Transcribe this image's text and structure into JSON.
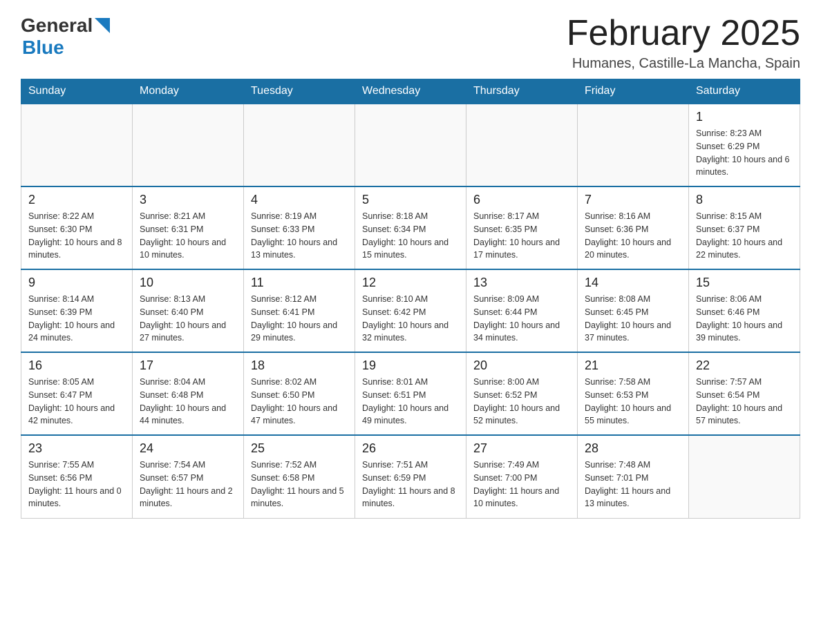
{
  "header": {
    "logo": {
      "general": "General",
      "blue": "Blue"
    },
    "title": "February 2025",
    "subtitle": "Humanes, Castille-La Mancha, Spain"
  },
  "weekdays": [
    "Sunday",
    "Monday",
    "Tuesday",
    "Wednesday",
    "Thursday",
    "Friday",
    "Saturday"
  ],
  "weeks": [
    [
      {
        "day": "",
        "info": ""
      },
      {
        "day": "",
        "info": ""
      },
      {
        "day": "",
        "info": ""
      },
      {
        "day": "",
        "info": ""
      },
      {
        "day": "",
        "info": ""
      },
      {
        "day": "",
        "info": ""
      },
      {
        "day": "1",
        "info": "Sunrise: 8:23 AM\nSunset: 6:29 PM\nDaylight: 10 hours and 6 minutes."
      }
    ],
    [
      {
        "day": "2",
        "info": "Sunrise: 8:22 AM\nSunset: 6:30 PM\nDaylight: 10 hours and 8 minutes."
      },
      {
        "day": "3",
        "info": "Sunrise: 8:21 AM\nSunset: 6:31 PM\nDaylight: 10 hours and 10 minutes."
      },
      {
        "day": "4",
        "info": "Sunrise: 8:19 AM\nSunset: 6:33 PM\nDaylight: 10 hours and 13 minutes."
      },
      {
        "day": "5",
        "info": "Sunrise: 8:18 AM\nSunset: 6:34 PM\nDaylight: 10 hours and 15 minutes."
      },
      {
        "day": "6",
        "info": "Sunrise: 8:17 AM\nSunset: 6:35 PM\nDaylight: 10 hours and 17 minutes."
      },
      {
        "day": "7",
        "info": "Sunrise: 8:16 AM\nSunset: 6:36 PM\nDaylight: 10 hours and 20 minutes."
      },
      {
        "day": "8",
        "info": "Sunrise: 8:15 AM\nSunset: 6:37 PM\nDaylight: 10 hours and 22 minutes."
      }
    ],
    [
      {
        "day": "9",
        "info": "Sunrise: 8:14 AM\nSunset: 6:39 PM\nDaylight: 10 hours and 24 minutes."
      },
      {
        "day": "10",
        "info": "Sunrise: 8:13 AM\nSunset: 6:40 PM\nDaylight: 10 hours and 27 minutes."
      },
      {
        "day": "11",
        "info": "Sunrise: 8:12 AM\nSunset: 6:41 PM\nDaylight: 10 hours and 29 minutes."
      },
      {
        "day": "12",
        "info": "Sunrise: 8:10 AM\nSunset: 6:42 PM\nDaylight: 10 hours and 32 minutes."
      },
      {
        "day": "13",
        "info": "Sunrise: 8:09 AM\nSunset: 6:44 PM\nDaylight: 10 hours and 34 minutes."
      },
      {
        "day": "14",
        "info": "Sunrise: 8:08 AM\nSunset: 6:45 PM\nDaylight: 10 hours and 37 minutes."
      },
      {
        "day": "15",
        "info": "Sunrise: 8:06 AM\nSunset: 6:46 PM\nDaylight: 10 hours and 39 minutes."
      }
    ],
    [
      {
        "day": "16",
        "info": "Sunrise: 8:05 AM\nSunset: 6:47 PM\nDaylight: 10 hours and 42 minutes."
      },
      {
        "day": "17",
        "info": "Sunrise: 8:04 AM\nSunset: 6:48 PM\nDaylight: 10 hours and 44 minutes."
      },
      {
        "day": "18",
        "info": "Sunrise: 8:02 AM\nSunset: 6:50 PM\nDaylight: 10 hours and 47 minutes."
      },
      {
        "day": "19",
        "info": "Sunrise: 8:01 AM\nSunset: 6:51 PM\nDaylight: 10 hours and 49 minutes."
      },
      {
        "day": "20",
        "info": "Sunrise: 8:00 AM\nSunset: 6:52 PM\nDaylight: 10 hours and 52 minutes."
      },
      {
        "day": "21",
        "info": "Sunrise: 7:58 AM\nSunset: 6:53 PM\nDaylight: 10 hours and 55 minutes."
      },
      {
        "day": "22",
        "info": "Sunrise: 7:57 AM\nSunset: 6:54 PM\nDaylight: 10 hours and 57 minutes."
      }
    ],
    [
      {
        "day": "23",
        "info": "Sunrise: 7:55 AM\nSunset: 6:56 PM\nDaylight: 11 hours and 0 minutes."
      },
      {
        "day": "24",
        "info": "Sunrise: 7:54 AM\nSunset: 6:57 PM\nDaylight: 11 hours and 2 minutes."
      },
      {
        "day": "25",
        "info": "Sunrise: 7:52 AM\nSunset: 6:58 PM\nDaylight: 11 hours and 5 minutes."
      },
      {
        "day": "26",
        "info": "Sunrise: 7:51 AM\nSunset: 6:59 PM\nDaylight: 11 hours and 8 minutes."
      },
      {
        "day": "27",
        "info": "Sunrise: 7:49 AM\nSunset: 7:00 PM\nDaylight: 11 hours and 10 minutes."
      },
      {
        "day": "28",
        "info": "Sunrise: 7:48 AM\nSunset: 7:01 PM\nDaylight: 11 hours and 13 minutes."
      },
      {
        "day": "",
        "info": ""
      }
    ]
  ]
}
